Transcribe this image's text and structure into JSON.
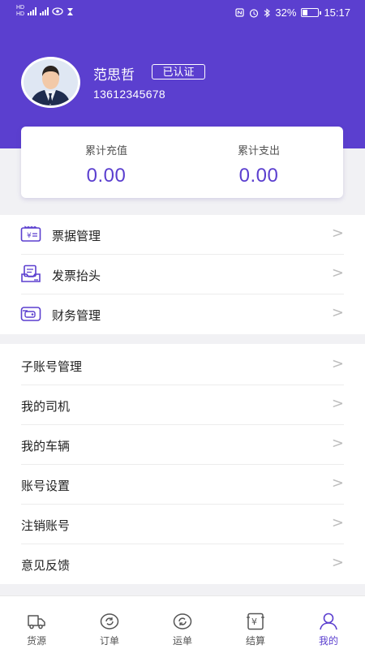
{
  "status_bar": {
    "battery": "32%",
    "time": "15:17"
  },
  "profile": {
    "name": "范思哲",
    "badge": "已认证",
    "phone": "13612345678"
  },
  "stats": [
    {
      "label": "累计充值",
      "value": "0.00"
    },
    {
      "label": "累计支出",
      "value": "0.00"
    }
  ],
  "menu_group_1": [
    {
      "label": "票据管理",
      "icon": "receipt-icon"
    },
    {
      "label": "发票抬头",
      "icon": "invoice-icon"
    },
    {
      "label": "财务管理",
      "icon": "wallet-icon"
    }
  ],
  "menu_group_2": [
    {
      "label": "子账号管理"
    },
    {
      "label": "我的司机"
    },
    {
      "label": "我的车辆"
    },
    {
      "label": "账号设置"
    },
    {
      "label": "注销账号"
    },
    {
      "label": "意见反馈"
    }
  ],
  "chevron": ">",
  "tabs": [
    {
      "label": "货源",
      "icon": "truck-icon"
    },
    {
      "label": "订单",
      "icon": "order-icon"
    },
    {
      "label": "运单",
      "icon": "waybill-icon"
    },
    {
      "label": "结算",
      "icon": "settlement-icon"
    },
    {
      "label": "我的",
      "icon": "profile-icon"
    }
  ],
  "active_tab": "我的",
  "colors": {
    "accent": "#5b3fcf",
    "background": "#f1f1f4"
  }
}
